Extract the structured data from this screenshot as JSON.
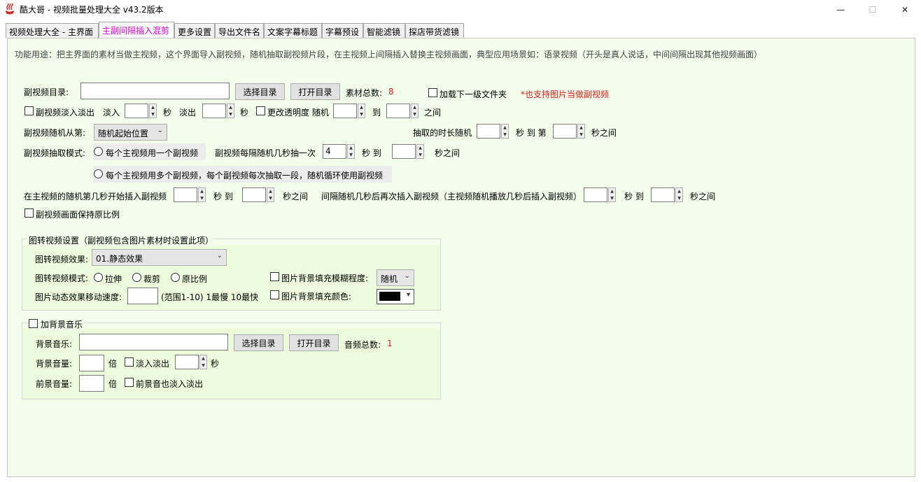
{
  "window": {
    "title": "酷大哥 -  视频批量处理大全  v43.2版本",
    "app_icon": "hot-spring-icon",
    "minimize": "—",
    "maximize": "☐",
    "close": "✕"
  },
  "tabs": [
    {
      "label": "视频处理大全 - 主界面",
      "active": false
    },
    {
      "label": "主副间隔插入混剪",
      "active": true
    },
    {
      "label": "更多设置",
      "active": false
    },
    {
      "label": "导出文件名",
      "active": false
    },
    {
      "label": "文案字幕标题",
      "active": false
    },
    {
      "label": "字幕预设",
      "active": false
    },
    {
      "label": "智能滤镜",
      "active": false
    },
    {
      "label": "探店带货滤镜",
      "active": false
    }
  ],
  "description": "功能用途：把主界面的素材当做主视频，这个界面导入副视频，随机抽取副视频片段，在主视频上间隔插入替换主视频画面，典型应用场景如：语录视频（开头是真人说话，中间间隔出现其他视频画面）",
  "sub_video": {
    "dir_label": "副视频目录:",
    "dir_value": "",
    "select_dir": "选择目录",
    "open_dir": "打开目录",
    "count_label": "素材总数:",
    "count_value": "8",
    "load_subfolder": "加载下一级文件夹",
    "image_note": "*也支持图片当做副视频",
    "fade_label": "副视频淡入淡出",
    "fade_in_label": "淡入",
    "sec": "秒",
    "fade_out_label": "淡出",
    "change_opacity": "更改透明度 随机",
    "to": "到",
    "between": "之间",
    "random_from_label": "副视频随机从第:",
    "random_from_value": "随机起始位置",
    "duration_label": "抽取的时长随机",
    "sec_to_nth": "秒 到 第",
    "sec_between": "秒之间",
    "mode_label": "副视频抽取模式:",
    "mode_single": "每个主视频用一个副视频",
    "every_n_label": "副视频每隔随机几秒抽一次",
    "every_n_value": "4",
    "sec_to": "秒 到",
    "mode_multi": "每个主视频用多个副视频，每个副视频每次抽取一段，随机循环使用副视频",
    "insert_start_label": "在主视频的随机第几秒开始插入副视频",
    "interval_label": "间隔随机几秒后再次插入副视频（主视频随机播放几秒后插入副视频）",
    "keep_ratio": "副视频画面保持原比例"
  },
  "image_group": {
    "title": "图转视频设置（副视频包含图片素材时设置此项）",
    "effect_label": "图转视频效果:",
    "effect_value": "01.静态效果",
    "mode_label": "图转视频模式:",
    "mode_stretch": "拉伸",
    "mode_crop": "裁剪",
    "mode_original": "原比例",
    "blur_label": "图片背景填充模糊程度:",
    "blur_value": "随机",
    "speed_label": "图片动态效果移动速度:",
    "speed_value": "",
    "speed_hint": "(范围1-10)  1最慢 10最快",
    "bgcolor_label": "图片背景填充颜色:",
    "bgcolor_value": "#000000"
  },
  "music_group": {
    "title": "加背景音乐",
    "bg_music_label": "背景音乐:",
    "bg_music_value": "",
    "select_dir": "选择目录",
    "open_dir": "打开目录",
    "count_label": "音频总数:",
    "count_value": "1",
    "bg_volume_label": "背景音量:",
    "times": "倍",
    "fade": "淡入淡出",
    "sec": "秒",
    "fg_volume_label": "前景音量:",
    "fg_fade": "前景音也淡入淡出"
  }
}
